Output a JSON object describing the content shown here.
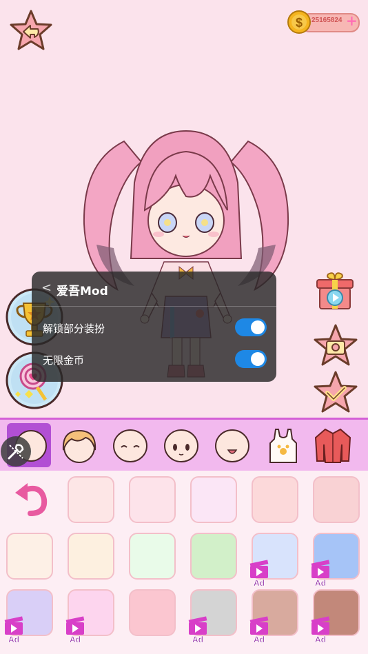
{
  "coins": {
    "value": "25165824",
    "plus": "+",
    "currency_icon": "dollar-coin-icon"
  },
  "mod_panel": {
    "back": "<",
    "title": "爱吾Mod",
    "options": [
      {
        "label": "解锁部分装扮",
        "enabled": true
      },
      {
        "label": "无限金币",
        "enabled": true
      }
    ]
  },
  "categories": [
    {
      "name": "face-shape",
      "active": true
    },
    {
      "name": "hairstyle",
      "active": false
    },
    {
      "name": "eyes",
      "active": false
    },
    {
      "name": "face-expression",
      "active": false
    },
    {
      "name": "mouth",
      "active": false
    },
    {
      "name": "top",
      "active": false
    },
    {
      "name": "jacket",
      "active": false
    }
  ],
  "swatches": [
    {
      "color": "#fde6e6",
      "ad": false
    },
    {
      "color": "#fde3ea",
      "ad": false
    },
    {
      "color": "#fbe6f6",
      "ad": false
    },
    {
      "color": "#fcd9da",
      "ad": false
    },
    {
      "color": "#f9d2d4",
      "ad": false
    },
    {
      "color": "#fdf0e6",
      "ad": false
    },
    {
      "color": "#fdf0e0",
      "ad": false
    },
    {
      "color": "#e9fbe9",
      "ad": false
    },
    {
      "color": "#d2f0c9",
      "ad": false
    },
    {
      "color": "#d8e3fc",
      "ad": true
    },
    {
      "color": "#a6c4f7",
      "ad": true
    },
    {
      "color": "#d9cff7",
      "ad": true
    },
    {
      "color": "#fdd5ee",
      "ad": true
    },
    {
      "color": "#fbc6d0",
      "ad": false
    },
    {
      "color": "#d4d4d4",
      "ad": true
    },
    {
      "color": "#d8aa9e",
      "ad": true
    },
    {
      "color": "#c2887a",
      "ad": true
    }
  ],
  "ad_label": "Ad",
  "colors": {
    "accent": "#d45fd6",
    "panel": "#282828",
    "toggle": "#1e88e5",
    "background": "#fbe3ec"
  }
}
